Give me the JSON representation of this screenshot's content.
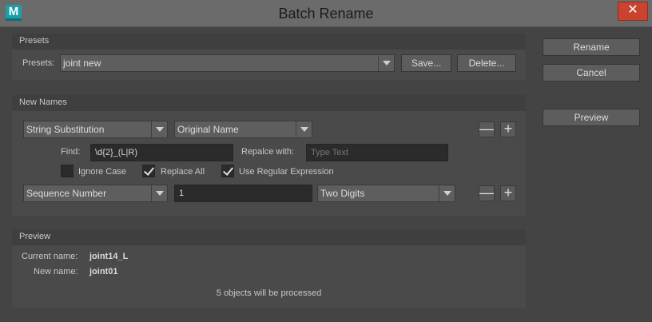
{
  "window": {
    "title": "Batch Rename",
    "app_icon_letter": "M",
    "close_symbol": "✕"
  },
  "presets": {
    "group_label": "Presets",
    "label": "Presets:",
    "selected": "joint new",
    "save_button": "Save...",
    "delete_button": "Delete..."
  },
  "actions": {
    "rename": "Rename",
    "cancel": "Cancel",
    "preview": "Preview"
  },
  "new_names": {
    "group_label": "New Names",
    "row1": {
      "operation": "String Substitution",
      "source": "Original Name",
      "remove_symbol": "—",
      "add_symbol": "+"
    },
    "find_label": "Find:",
    "find_value": "\\d{2}_(L|R)",
    "replace_label": "Repalce with:",
    "replace_placeholder": "Type Text",
    "ignore_case": {
      "label": "Ignore Case",
      "checked": false
    },
    "replace_all": {
      "label": "Replace All",
      "checked": true
    },
    "use_regex": {
      "label": "Use Regular Expression",
      "checked": true
    },
    "row2": {
      "operation": "Sequence Number",
      "start_value": "1",
      "digits": "Two Digits",
      "remove_symbol": "—",
      "add_symbol": "+"
    }
  },
  "preview": {
    "group_label": "Preview",
    "current_label": "Current name:",
    "current_value": "joint14_L",
    "new_label": "New name:",
    "new_value": "joint01",
    "status": "5 objects will be processed"
  }
}
